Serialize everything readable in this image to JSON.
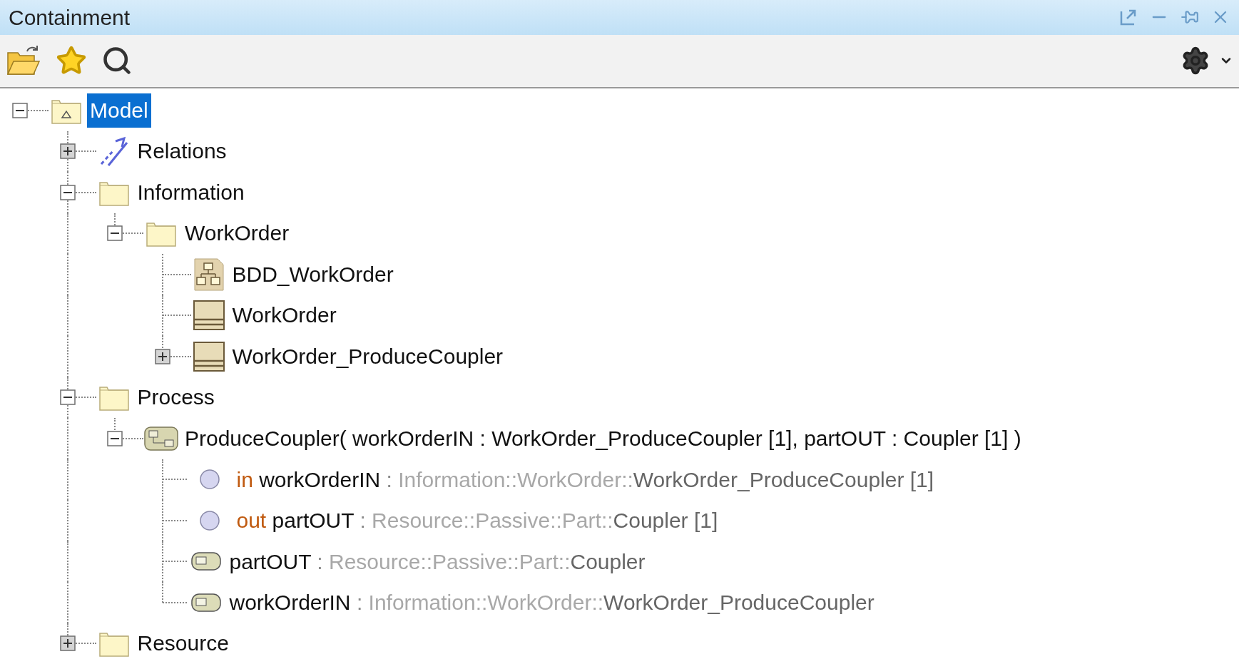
{
  "window": {
    "title": "Containment"
  },
  "tree": [
    {
      "kind": "model",
      "label": "Model",
      "expanded": true,
      "selected": true,
      "children": [
        {
          "kind": "relations",
          "label": "Relations",
          "expanded": false,
          "selected": false
        },
        {
          "kind": "folder",
          "label": "Information",
          "expanded": true,
          "selected": false,
          "children": [
            {
              "kind": "folder",
              "label": "WorkOrder",
              "expanded": true,
              "selected": false,
              "children": [
                {
                  "kind": "diagram",
                  "label": "BDD_WorkOrder",
                  "selected": false
                },
                {
                  "kind": "block",
                  "label": "WorkOrder",
                  "selected": false
                },
                {
                  "kind": "block",
                  "label": "WorkOrder_ProduceCoupler",
                  "expanded": false,
                  "selected": false
                }
              ]
            }
          ]
        },
        {
          "kind": "folder",
          "label": "Process",
          "expanded": true,
          "selected": false,
          "children": [
            {
              "kind": "activity",
              "label": "ProduceCoupler( workOrderIN : WorkOrder_ProduceCoupler [1], partOUT : Coupler [1] )",
              "expanded": true,
              "selected": false,
              "children": [
                {
                  "kind": "parameter",
                  "direction": "in",
                  "label": "workOrderIN",
                  "separator": ":",
                  "type_path": "Information::WorkOrder::",
                  "type_name": "WorkOrder_ProduceCoupler [1]",
                  "selected": false
                },
                {
                  "kind": "parameter",
                  "direction": "out",
                  "label": "partOUT",
                  "separator": ":",
                  "type_path": "Resource::Passive::Part::",
                  "type_name": "Coupler [1]",
                  "selected": false
                },
                {
                  "kind": "pin",
                  "label": "partOUT",
                  "separator": ":",
                  "type_path": "Resource::Passive::Part::",
                  "type_name": "Coupler",
                  "selected": false
                },
                {
                  "kind": "pin",
                  "label": "workOrderIN",
                  "separator": ":",
                  "type_path": "Information::WorkOrder::",
                  "type_name": "WorkOrder_ProduceCoupler",
                  "selected": false
                }
              ]
            }
          ]
        },
        {
          "kind": "folder",
          "label": "Resource",
          "expanded": false,
          "selected": false
        }
      ]
    }
  ]
}
